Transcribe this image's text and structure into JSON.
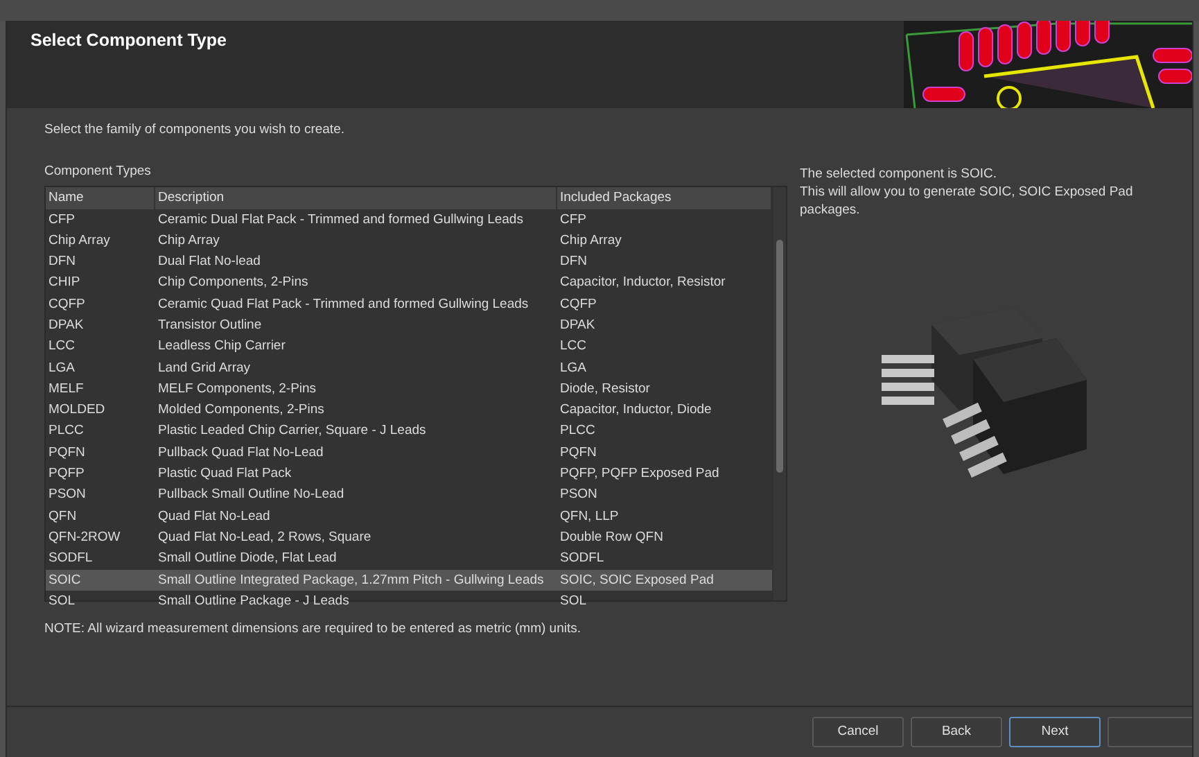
{
  "header": {
    "title": "Select Component Type"
  },
  "intro": "Select the family of components you wish to create.",
  "table": {
    "label": "Component Types",
    "columns": [
      "Name",
      "Description",
      "Included Packages"
    ],
    "rows": [
      {
        "name": "CFP",
        "description": "Ceramic Dual Flat Pack - Trimmed and formed Gullwing Leads",
        "packages": "CFP",
        "selected": false
      },
      {
        "name": "Chip Array",
        "description": "Chip Array",
        "packages": "Chip Array",
        "selected": false
      },
      {
        "name": "DFN",
        "description": "Dual Flat No-lead",
        "packages": "DFN",
        "selected": false
      },
      {
        "name": "CHIP",
        "description": "Chip Components, 2-Pins",
        "packages": "Capacitor, Inductor, Resistor",
        "selected": false
      },
      {
        "name": "CQFP",
        "description": "Ceramic Quad Flat Pack - Trimmed and formed Gullwing Leads",
        "packages": "CQFP",
        "selected": false
      },
      {
        "name": "DPAK",
        "description": "Transistor Outline",
        "packages": "DPAK",
        "selected": false
      },
      {
        "name": "LCC",
        "description": "Leadless Chip Carrier",
        "packages": "LCC",
        "selected": false
      },
      {
        "name": "LGA",
        "description": "Land Grid Array",
        "packages": "LGA",
        "selected": false
      },
      {
        "name": "MELF",
        "description": "MELF Components, 2-Pins",
        "packages": "Diode, Resistor",
        "selected": false
      },
      {
        "name": "MOLDED",
        "description": "Molded Components, 2-Pins",
        "packages": "Capacitor, Inductor, Diode",
        "selected": false
      },
      {
        "name": "PLCC",
        "description": "Plastic Leaded Chip Carrier, Square - J Leads",
        "packages": "PLCC",
        "selected": false
      },
      {
        "name": "PQFN",
        "description": "Pullback Quad Flat No-Lead",
        "packages": "PQFN",
        "selected": false
      },
      {
        "name": "PQFP",
        "description": "Plastic Quad Flat Pack",
        "packages": "PQFP, PQFP Exposed Pad",
        "selected": false
      },
      {
        "name": "PSON",
        "description": "Pullback Small Outline No-Lead",
        "packages": "PSON",
        "selected": false
      },
      {
        "name": "QFN",
        "description": "Quad Flat No-Lead",
        "packages": "QFN, LLP",
        "selected": false
      },
      {
        "name": "QFN-2ROW",
        "description": "Quad Flat No-Lead, 2 Rows, Square",
        "packages": "Double Row QFN",
        "selected": false
      },
      {
        "name": "SODFL",
        "description": "Small Outline Diode, Flat Lead",
        "packages": "SODFL",
        "selected": false
      },
      {
        "name": "SOIC",
        "description": "Small Outline Integrated Package, 1.27mm Pitch - Gullwing Leads",
        "packages": "SOIC, SOIC Exposed Pad",
        "selected": true
      },
      {
        "name": "SOL",
        "description": "Small Outline Package - J Leads",
        "packages": "SOL",
        "selected": false
      }
    ]
  },
  "info": [
    "The selected component is SOIC.",
    "This will allow you to generate SOIC, SOIC Exposed Pad packages."
  ],
  "note": "NOTE: All wizard measurement dimensions are required to be entered as metric (mm) units.",
  "buttons": [
    {
      "label": "Cancel",
      "focused": false
    },
    {
      "label": "Back",
      "focused": false
    },
    {
      "label": "Next",
      "focused": true
    },
    {
      "focused": false
    }
  ]
}
